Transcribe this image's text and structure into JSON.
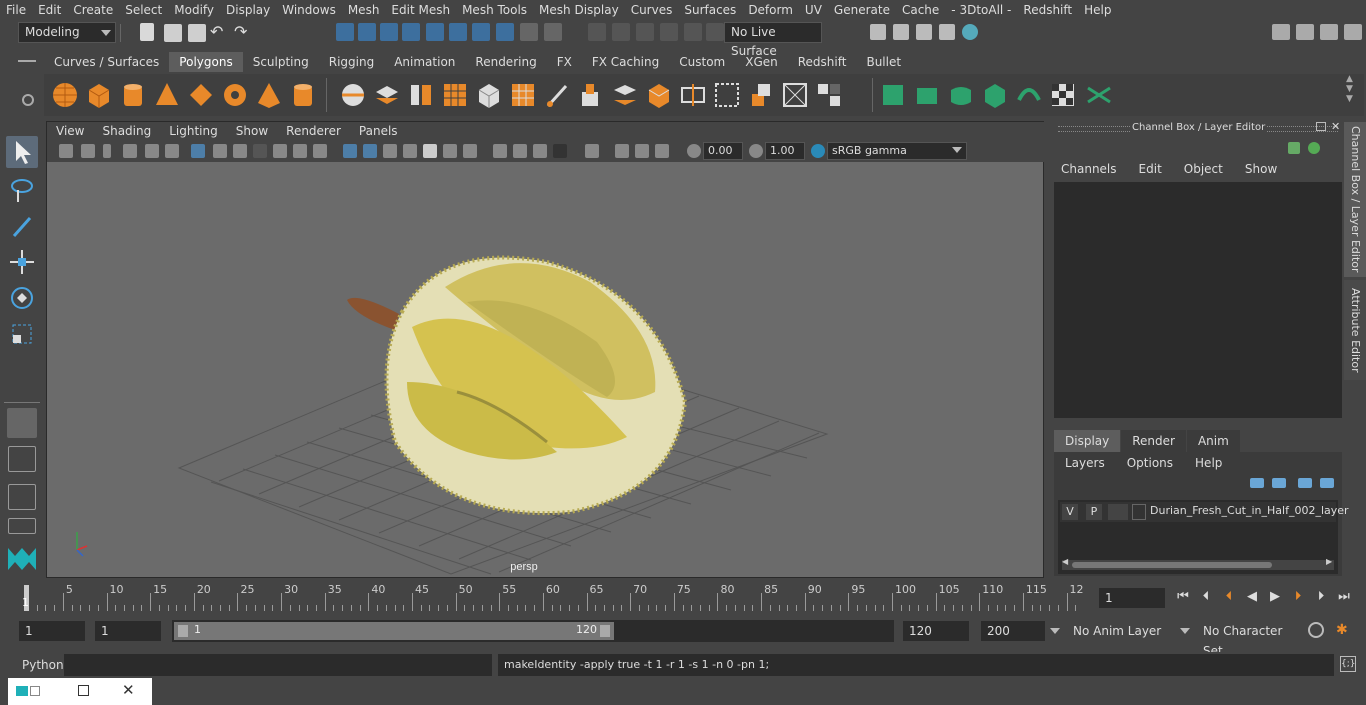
{
  "menubar": [
    "File",
    "Edit",
    "Create",
    "Select",
    "Modify",
    "Display",
    "Windows",
    "Mesh",
    "Edit Mesh",
    "Mesh Tools",
    "Mesh Display",
    "Curves",
    "Surfaces",
    "Deform",
    "UV",
    "Generate",
    "Cache",
    "- 3DtoAll -",
    "Redshift",
    "Help"
  ],
  "status": {
    "mode": "Modeling",
    "live_surface": "No Live Surface"
  },
  "shelf_tabs": [
    "Curves / Surfaces",
    "Polygons",
    "Sculpting",
    "Rigging",
    "Animation",
    "Rendering",
    "FX",
    "FX Caching",
    "Custom",
    "XGen",
    "Redshift",
    "Bullet"
  ],
  "shelf_active": "Polygons",
  "viewport": {
    "menu": [
      "View",
      "Shading",
      "Lighting",
      "Show",
      "Renderer",
      "Panels"
    ],
    "exposure": "0.00",
    "gamma": "1.00",
    "color_space": "sRGB gamma",
    "camera_label": "persp"
  },
  "channel_box": {
    "title": "Channel Box / Layer Editor",
    "menu": [
      "Channels",
      "Edit",
      "Object",
      "Show"
    ],
    "tabs": [
      "Display",
      "Render",
      "Anim"
    ],
    "active_tab": "Display",
    "layer_menu": [
      "Layers",
      "Options",
      "Help"
    ],
    "layer": {
      "v": "V",
      "p": "P",
      "name": "Durian_Fresh_Cut_in_Half_002_layer"
    },
    "side_tabs": [
      "Channel Box / Layer Editor",
      "Attribute Editor"
    ]
  },
  "timeline": {
    "ticks": [
      "5",
      "10",
      "15",
      "20",
      "25",
      "30",
      "35",
      "40",
      "45",
      "50",
      "55",
      "60",
      "65",
      "70",
      "75",
      "80",
      "85",
      "90",
      "95",
      "100",
      "105",
      "110",
      "115",
      "12"
    ],
    "start_marker": "1",
    "current_frame": "1"
  },
  "range": {
    "start": "1",
    "playback_start": "1",
    "slider_start": "1",
    "slider_end": "120",
    "playback_end": "120",
    "end": "200",
    "anim_layer": "No Anim Layer",
    "character_set": "No Character Set"
  },
  "command": {
    "language": "Python",
    "feedback": "makeIdentity -apply true -t 1 -r 1 -s 1 -n 0 -pn 1;"
  }
}
